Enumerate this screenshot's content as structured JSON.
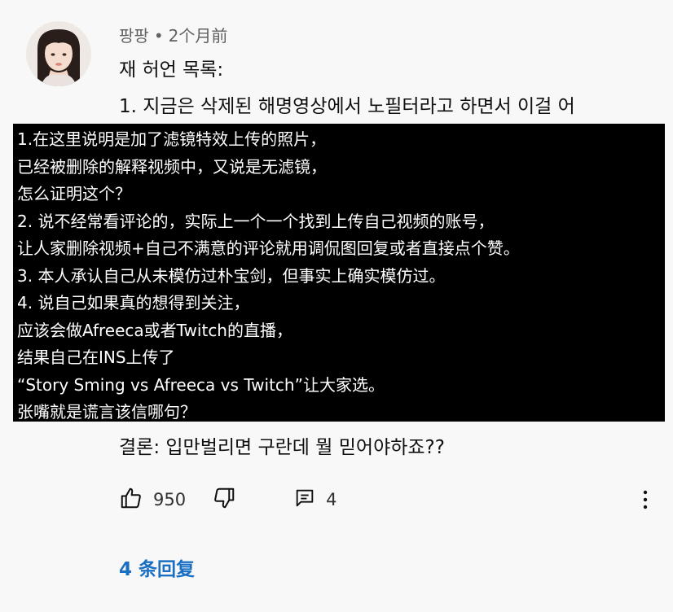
{
  "comment": {
    "author": "팡팡",
    "separator": "•",
    "time": "2个月前",
    "text_line1": "재 허언 목록:",
    "text_line2": "1. 지금은 삭제된 해명영상에서 노필터라고 하면서 이걸 어",
    "conclusion": "결론: 입만벌리면 구란데 뭘 믿어야하죠??"
  },
  "translation_box": {
    "lines": [
      "1.在这里说明是加了滤镜特效上传的照片，",
      "已经被删除的解释视频中，又说是无滤镜，",
      "怎么证明这个？",
      "2. 说不经常看评论的，实际上一个一个找到上传自己视频的账号，",
      "让人家删除视频+自己不满意的评论就用调侃图回复或者直接点个赞。",
      "3. 本人承认自己从未模仿过朴宝剑，但事实上确实模仿过。",
      "4. 说自己如果真的想得到关注，",
      "应该会做Afreeca或者Twitch的直播，",
      "结果自己在INS上传了",
      "“Story Sming vs Afreeca vs Twitch”让大家选。",
      "张嘴就是谎言该信哪句？"
    ]
  },
  "actions": {
    "like_icon": "thumbs-up-icon",
    "like_count": "950",
    "dislike_icon": "thumbs-down-icon",
    "comment_icon": "comment-icon",
    "comment_count": "4",
    "more_icon": "more-vertical-icon"
  },
  "replies": {
    "label": "4 条回复"
  },
  "colors": {
    "background": "#f8f8f8",
    "box_background": "#000000",
    "box_text": "#ffffff",
    "meta_text": "#606060",
    "reply_link": "#1a6fc2"
  }
}
